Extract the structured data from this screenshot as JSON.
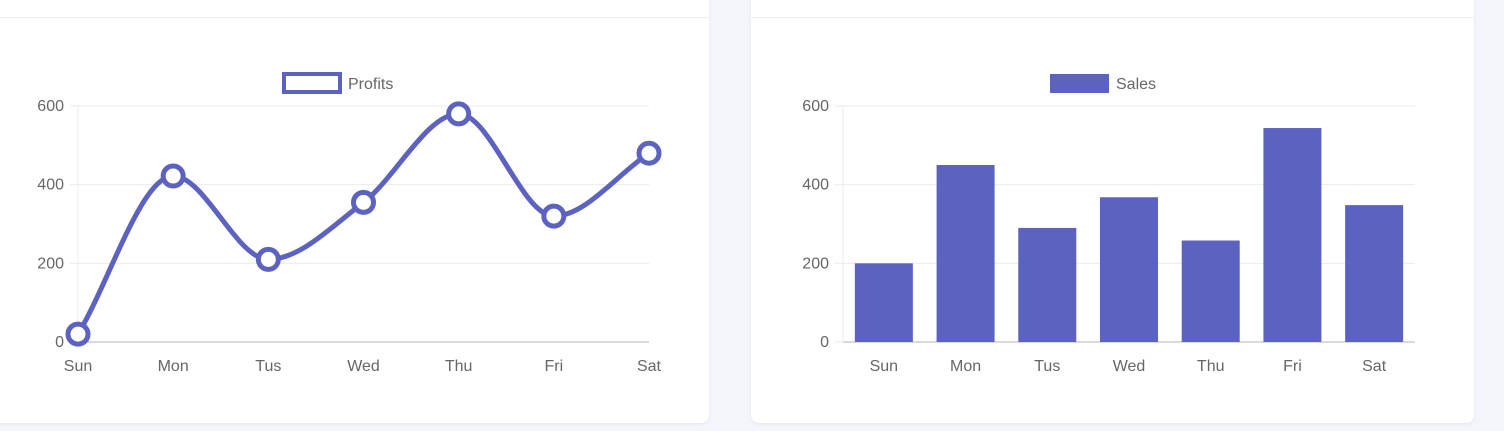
{
  "accent_color": "#5c62c0",
  "grid_color": "#ebebef",
  "axis_color": "#b4b4b4",
  "chart_data": [
    {
      "type": "line",
      "smooth": true,
      "categories": [
        "Sun",
        "Mon",
        "Tus",
        "Wed",
        "Thu",
        "Fri",
        "Sat"
      ],
      "series": [
        {
          "name": "Profits",
          "values": [
            20,
            422,
            210,
            355,
            580,
            320,
            480
          ]
        }
      ],
      "yticks": [
        0,
        200,
        400,
        600
      ],
      "ylim": [
        0,
        600
      ],
      "grid": true,
      "legend": "top-center"
    },
    {
      "type": "bar",
      "categories": [
        "Sun",
        "Mon",
        "Tus",
        "Wed",
        "Thu",
        "Fri",
        "Sat"
      ],
      "series": [
        {
          "name": "Sales",
          "values": [
            200,
            450,
            290,
            368,
            258,
            544,
            348
          ]
        }
      ],
      "yticks": [
        0,
        200,
        400,
        600
      ],
      "ylim": [
        0,
        600
      ],
      "grid": true,
      "legend": "top-center"
    }
  ]
}
